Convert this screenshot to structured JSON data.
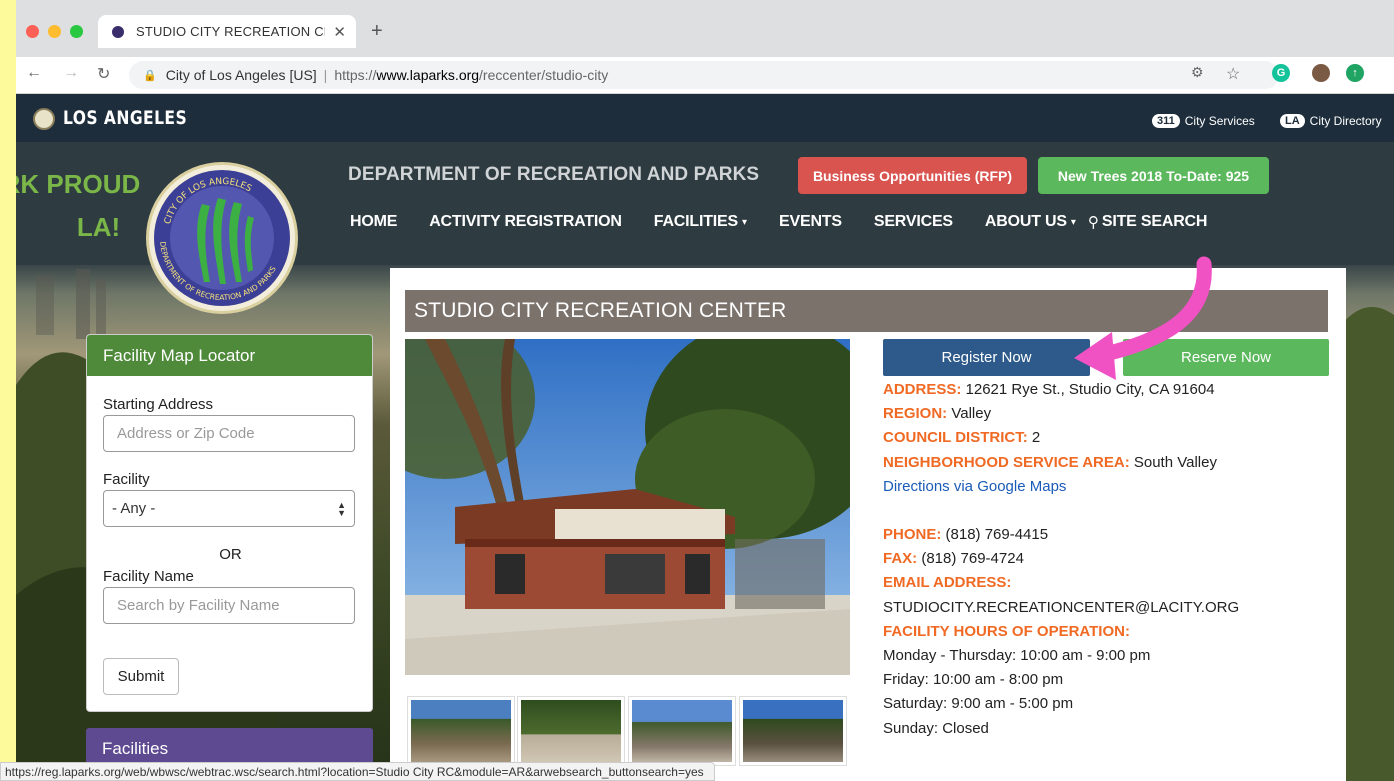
{
  "browser": {
    "tab_title": "STUDIO CITY RECREATION CE",
    "url_site_label": "City of Los Angeles [US]",
    "url_scheme": "https://",
    "url_domain": "www.laparks.org",
    "url_path": "/reccenter/studio-city",
    "status_url": "https://reg.laparks.org/web/wbwsc/webtrac.wsc/search.html?location=Studio City RC&module=AR&arwebsearch_buttonsearch=yes"
  },
  "topbar": {
    "brand": "LOS ANGELES",
    "services_badge": "311",
    "services_label": "City Services",
    "directory_badge": "LA",
    "directory_label": "City Directory"
  },
  "header": {
    "slogan_line1": "RK PROUD",
    "slogan_line2": "LA!",
    "dept_title": "DEPARTMENT OF RECREATION AND PARKS",
    "rfp_button": "Business Opportunities (RFP)",
    "trees_button": "New Trees 2018 To-Date: 925",
    "nav": [
      "HOME",
      "ACTIVITY REGISTRATION",
      "FACILITIES",
      "EVENTS",
      "SERVICES",
      "ABOUT US",
      "SITE SEARCH"
    ]
  },
  "logo": {
    "ring_text_top": "CITY OF LOS ANGELES",
    "ring_text_bottom": "DEPARTMENT OF RECREATION AND PARKS"
  },
  "locator": {
    "title": "Facility Map Locator",
    "starting_label": "Starting Address",
    "starting_placeholder": "Address or Zip Code",
    "facility_label": "Facility",
    "facility_value": "- Any -",
    "or_text": "OR",
    "name_label": "Facility Name",
    "name_placeholder": "Search by Facility Name",
    "submit": "Submit"
  },
  "facilities_card": {
    "title": "Facilities"
  },
  "main": {
    "page_title": "STUDIO CITY RECREATION CENTER",
    "register_button": "Register Now",
    "reserve_button": "Reserve Now",
    "address_key": "ADDRESS:",
    "address_value": " 12621 Rye St., Studio City, CA 91604",
    "region_key": "REGION:",
    "region_value": " Valley",
    "council_key": "COUNCIL DISTRICT:",
    "council_value": " 2",
    "nsa_key": "NEIGHBORHOOD SERVICE AREA:",
    "nsa_value": " South Valley",
    "directions": "Directions via Google Maps",
    "phone_key": "PHONE:",
    "phone_value": " (818) 769-4415",
    "fax_key": "FAX:",
    "fax_value": " (818) 769-4724",
    "email_key": "EMAIL ADDRESS:",
    "email_value": "STUDIOCITY.RECREATIONCENTER@LACITY.ORG",
    "hours_key": "FACILITY HOURS OF OPERATION:",
    "hours": [
      "Monday - Thursday: 10:00 am - 9:00 pm",
      "Friday: 10:00 am - 8:00 pm",
      "Saturday: 9:00 am - 5:00 pm",
      "Sunday: Closed"
    ]
  },
  "colors": {
    "accent_green": "#5cb85c",
    "register_blue": "#2d5a8a",
    "rfp_red": "#d9534f",
    "label_orange": "#f06a24",
    "annotation_arrow": "#f052c3",
    "title_bar": "#7c726c",
    "header_dark": "#1d2d3b",
    "locator_green": "#4e8a3a",
    "facilities_purple": "#5e4a91"
  }
}
